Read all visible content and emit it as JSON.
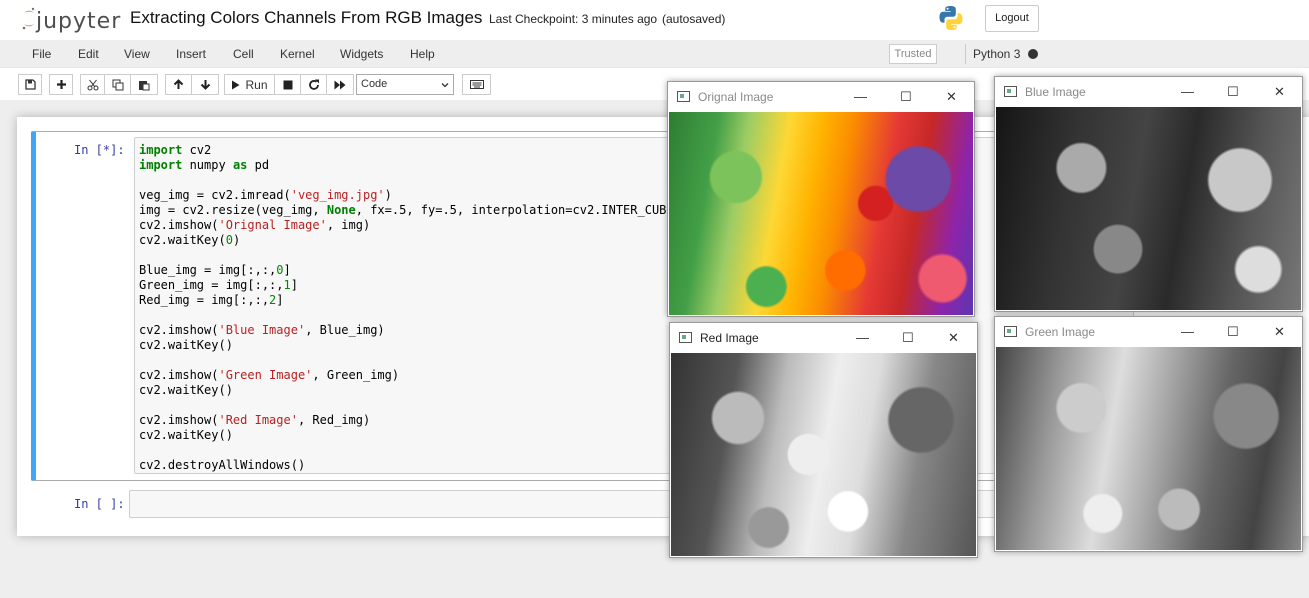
{
  "header": {
    "logo_text": "jupyter",
    "notebook_title": "Extracting Colors Channels From RGB Images",
    "checkpoint": "Last Checkpoint: 3 minutes ago",
    "autosave_status": "(autosaved)",
    "logout_label": "Logout"
  },
  "menubar": {
    "items": [
      "File",
      "Edit",
      "View",
      "Insert",
      "Cell",
      "Kernel",
      "Widgets",
      "Help"
    ],
    "trusted_label": "Trusted",
    "kernel_name": "Python 3"
  },
  "toolbar": {
    "run_label": "Run",
    "cell_type": "Code",
    "icons": [
      "save-icon",
      "plus-icon",
      "cut-icon",
      "copy-icon",
      "paste-icon",
      "arrow-up-icon",
      "arrow-down-icon",
      "run-icon",
      "stop-icon",
      "restart-icon",
      "fast-forward-icon",
      "keyboard-icon"
    ]
  },
  "cells": [
    {
      "prompt": "In [*]:",
      "lines": [
        [
          {
            "t": "import",
            "c": "kw"
          },
          {
            "t": " cv2"
          }
        ],
        [
          {
            "t": "import",
            "c": "kw"
          },
          {
            "t": " numpy "
          },
          {
            "t": "as",
            "c": "kw"
          },
          {
            "t": " pd"
          }
        ],
        [],
        [
          {
            "t": "veg_img = cv2.imread("
          },
          {
            "t": "'veg_img.jpg'",
            "c": "str"
          },
          {
            "t": ")"
          }
        ],
        [
          {
            "t": "img = cv2.resize(veg_img, "
          },
          {
            "t": "None",
            "c": "kw"
          },
          {
            "t": ", fx=.5, fy=.5, interpolation=cv2.INTER_CUBIC)"
          }
        ],
        [
          {
            "t": "cv2.imshow("
          },
          {
            "t": "'Orignal Image'",
            "c": "str"
          },
          {
            "t": ", img)"
          }
        ],
        [
          {
            "t": "cv2.waitKey("
          },
          {
            "t": "0",
            "c": "num"
          },
          {
            "t": ")"
          }
        ],
        [],
        [
          {
            "t": "Blue_img = img[:,:,"
          },
          {
            "t": "0",
            "c": "num"
          },
          {
            "t": "]"
          }
        ],
        [
          {
            "t": "Green_img = img[:,:,"
          },
          {
            "t": "1",
            "c": "num"
          },
          {
            "t": "]"
          }
        ],
        [
          {
            "t": "Red_img = img[:,:,"
          },
          {
            "t": "2",
            "c": "num"
          },
          {
            "t": "]"
          }
        ],
        [],
        [
          {
            "t": "cv2.imshow("
          },
          {
            "t": "'Blue Image'",
            "c": "str"
          },
          {
            "t": ", Blue_img)"
          }
        ],
        [
          {
            "t": "cv2.waitKey()"
          }
        ],
        [],
        [
          {
            "t": "cv2.imshow("
          },
          {
            "t": "'Green Image'",
            "c": "str"
          },
          {
            "t": ", Green_img)"
          }
        ],
        [
          {
            "t": "cv2.waitKey()"
          }
        ],
        [],
        [
          {
            "t": "cv2.imshow("
          },
          {
            "t": "'Red Image'",
            "c": "str"
          },
          {
            "t": ", Red_img)"
          }
        ],
        [
          {
            "t": "cv2.waitKey()"
          }
        ],
        [],
        [
          {
            "t": "cv2.destroyAllWindows()"
          }
        ]
      ]
    },
    {
      "prompt": "In [ ]:"
    }
  ],
  "windows": {
    "original": {
      "title": "Orignal Image"
    },
    "blue": {
      "title": "Blue Image"
    },
    "red": {
      "title": "Red Image"
    },
    "green": {
      "title": "Green Image"
    }
  },
  "colors": {
    "accent": "#42a5f5",
    "prompt": "#303f9f",
    "keyword": "#008000",
    "string": "#ba2121"
  }
}
